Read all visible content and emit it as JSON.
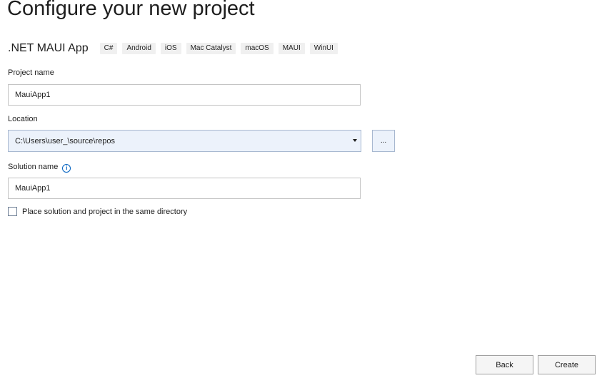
{
  "page_title": "Configure your new project",
  "template": {
    "name": ".NET MAUI App",
    "tags": [
      "C#",
      "Android",
      "iOS",
      "Mac Catalyst",
      "macOS",
      "MAUI",
      "WinUI"
    ]
  },
  "project_name": {
    "label": "Project name",
    "value": "MauiApp1"
  },
  "location": {
    "label": "Location",
    "value": "C:\\Users\\user_\\source\\repos",
    "browse_label": "..."
  },
  "solution_name": {
    "label": "Solution name",
    "value": "MauiApp1",
    "info_icon": "info-icon"
  },
  "same_directory": {
    "label": "Place solution and project in the same directory",
    "checked": false
  },
  "buttons": {
    "back": "Back",
    "create": "Create"
  },
  "colors": {
    "info_accent": "#0060c0",
    "combo_background": "#ecf2fb"
  }
}
